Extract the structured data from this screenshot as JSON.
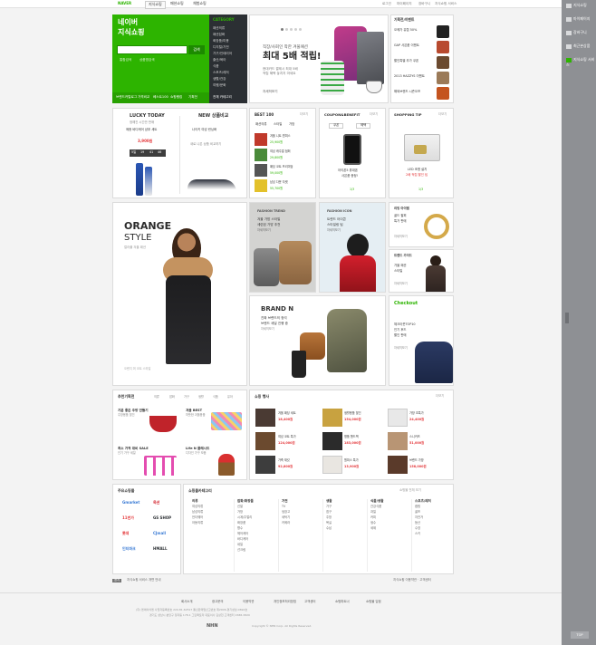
{
  "top": {
    "tabs": [
      "NAVER",
      "지식쇼핑",
      "패션쇼핑",
      "체험쇼핑"
    ],
    "util": [
      "로그인",
      "마이페이지",
      "장바구니",
      "지식쇼핑 서비스"
    ]
  },
  "right_bar": [
    "지식쇼핑",
    "마이페이지",
    "장바구니",
    "최근본상품",
    "지식쇼핑 서비스"
  ],
  "naver": {
    "title_line1": "네이버",
    "title_line2": "지식쇼핑",
    "search_button": "검색",
    "sub_links": [
      "통합검색",
      "상품명검색"
    ],
    "bottom_links": [
      "브랜드카탈로그",
      "가격비교",
      "베스트100",
      "쇼핑랭킹",
      "기획전"
    ]
  },
  "category": {
    "heading": "CATEGORY",
    "items": [
      "패션의류",
      "패션잡화",
      "화장품/미용",
      "디지털/가전",
      "가구/인테리어",
      "출산/육아",
      "식품",
      "스포츠/레저",
      "생활/건강",
      "여행/문화"
    ],
    "all_button": "전체 카테고리"
  },
  "hero": {
    "small": "직장/사회인 착한 겨울패션",
    "big": "최대 5배 적립!",
    "desc1": "현대카드 결제시 최대 5배",
    "desc2": "적립 혜택 놓치지 마세요",
    "link": "자세히보기"
  },
  "planning": {
    "title": "기획전/이벤트",
    "items": [
      "오메가 유렵 50%",
      "GAP 사은품 이벤트",
      "할인특별 추가 쿠폰",
      "2013 HAZZYS 이벤트",
      "해외브랜드 시즌오프"
    ]
  },
  "lucky": {
    "title": "LUCKY TODAY",
    "sub": "정해진 시간만 판매",
    "desc": "메종 바디케어 샴푸 세트",
    "price": "3,900원",
    "timer": [
      "5일",
      "19",
      "41",
      "46"
    ]
  },
  "newitem": {
    "title": "NEW 상품비교",
    "sub": "나이키 여성 런닝화",
    "desc": "새로 나온 상품 비교하기"
  },
  "best": {
    "title": "BEST 100",
    "more": "더보기",
    "tabs": [
      "패션의류",
      "스타일",
      "가방"
    ],
    "items": [
      {
        "name": "겨울 니트 원피스",
        "price": "25,900원"
      },
      {
        "name": "여성 캐주얼 점퍼",
        "price": "29,800원"
      },
      {
        "name": "패딩 코트 프리미엄",
        "price": "59,000원"
      },
      {
        "name": "남성 다운 자켓",
        "price": "55,700원"
      }
    ]
  },
  "coupon": {
    "title": "COUPON&BENEFIT",
    "more": "더보기",
    "tabs": [
      "쿠폰",
      "혜택"
    ],
    "desc1": "아이폰5 휴대폰",
    "desc2": "사은품 증정!"
  },
  "shoptip": {
    "title": "SHOPPING TIP",
    "more": "더보기",
    "desc1": "LED 조명 설치",
    "desc2": "2배 적립 할인 팁"
  },
  "orange": {
    "big": "ORANGE",
    "style": "STYLE",
    "sub": "컬러풀 겨울 패션",
    "caption": "오렌지 퍼 코트 스타일"
  },
  "fashion_trend": {
    "title": "FASHION TREND",
    "desc1": "겨울 가방 스타일",
    "desc2": "세련된 가방 추천",
    "link": "자세히보기"
  },
  "fashion_icon": {
    "title": "FASHION ICON",
    "desc1": "트렌드 아이콘",
    "desc2": "스타일링 팁",
    "link": "자세히보기"
  },
  "dp_item": {
    "title": "리빙 아이템",
    "desc1": "골드 팔찌",
    "desc2": "특가 판매",
    "link": "자세히보기"
  },
  "men": {
    "title": "트렌드 가이드",
    "desc1": "가을 패션",
    "desc2": "스타일",
    "link": "자세히보기"
  },
  "brand": {
    "title": "BRAND N",
    "desc1": "진짜 브랜드의 정석",
    "desc2": "브랜드 세일 진행 중",
    "link": "자세히보기"
  },
  "checkout": {
    "title": "Checkout",
    "desc1": "체크아웃TOP10",
    "desc2": "인기 후드",
    "desc3": "할인 판매",
    "link": "자세히보기"
  },
  "recommend": {
    "title": "추천기획전",
    "tabs": [
      "의류",
      "잡화",
      "가구",
      "생활",
      "식품",
      "유아"
    ],
    "items": [
      {
        "title": "기분 좋은 주방 만들기",
        "desc": "주방용품 할인"
      },
      {
        "title": "겨울 BEST",
        "desc": "따뜻한 겨울용품"
      },
      {
        "title": "최소 가격 대비 SALE",
        "desc": "인기 가구 세일"
      },
      {
        "title": "Life N 플래시드",
        "desc": "디자인 가구 모음"
      }
    ]
  },
  "sale": {
    "title": "쇼핑 행사",
    "more": "더보기",
    "items": [
      {
        "name": "겨울 패딩 세트",
        "price": "18,400원"
      },
      {
        "name": "생활용품 할인",
        "price": "154,000원"
      },
      {
        "name": "가방 초특가",
        "price": "24,400원"
      },
      {
        "name": "여성 코트 특가",
        "price": "124,000원"
      },
      {
        "name": "명품 핸드백",
        "price": "183,000원"
      },
      {
        "name": "스니커즈",
        "price": "51,000원"
      },
      {
        "name": "가죽 재킷",
        "price": "92,800원"
      },
      {
        "name": "원피스 특가",
        "price": "13,900원"
      },
      {
        "name": "브랜드 가방",
        "price": "158,000원"
      }
    ]
  },
  "malls": {
    "title": "주요쇼핑몰",
    "logos": [
      {
        "name": "Gmarket",
        "color": "#3a7bd5"
      },
      {
        "name": "옥션",
        "color": "#d3202a"
      },
      {
        "name": "11번가",
        "color": "#e4393c"
      },
      {
        "name": "GS SHOP",
        "color": "#2b2f33"
      },
      {
        "name": "롯데",
        "color": "#e4393c"
      },
      {
        "name": "CJmall",
        "color": "#3a7bd5"
      },
      {
        "name": "인터파크",
        "color": "#3a7bd5"
      },
      {
        "name": "HMALL",
        "color": "#2b2f33"
      }
    ]
  },
  "mall_categories": {
    "title": "쇼핑몰카테고리",
    "notice": "쇼핑몰 전체 보기",
    "columns": [
      {
        "title": "의류",
        "items": [
          "여성의류",
          "남성의류",
          "언더웨어",
          "아동의류"
        ]
      },
      {
        "title": "잡화/화장품",
        "items": [
          "신발",
          "가방",
          "시계/주얼리",
          "화장품",
          "향수",
          "헤어케어",
          "바디케어",
          "네일",
          "선크림"
        ]
      },
      {
        "title": "가전",
        "items": [
          "TV",
          "냉장고",
          "세탁기",
          "카메라"
        ]
      },
      {
        "title": "생활",
        "items": [
          "가구",
          "침구",
          "주방",
          "욕실",
          "수납"
        ]
      },
      {
        "title": "식품/생활",
        "items": [
          "건강식품",
          "과일",
          "커피",
          "생수",
          "세제"
        ]
      },
      {
        "title": "스포츠/레저",
        "items": [
          "캠핑",
          "골프",
          "자전거",
          "등산",
          "수영",
          "스키"
        ]
      }
    ]
  },
  "notice": {
    "label": "공지",
    "text": "지식쇼핑 서비스 개편 안내",
    "right": "지식쇼핑 이용약관 · 고객센터"
  },
  "footer": {
    "links": [
      "회사소개",
      "광고문의",
      "이용약관",
      "개인정보처리방침",
      "고객센터",
      "쇼핑파트너",
      "쇼핑몰 입점"
    ],
    "addr": "(주) 엔에이치엔 사업자등록번호 220-81-62517 통신판매업신고번호 제2006-경기성남-0692호",
    "addr2": "경기도 성남시 분당구 정자동 178-1 그린팩토리 대표이사 김상헌 고객센터 1588-3820",
    "logo": "NHN",
    "copyright": "Copyright © NHN Corp. All Rights Reserved."
  },
  "colors": {
    "green": "#2db400",
    "dark": "#2b2f33",
    "sidebar": "#8e9094",
    "accent": "#e4393c"
  }
}
